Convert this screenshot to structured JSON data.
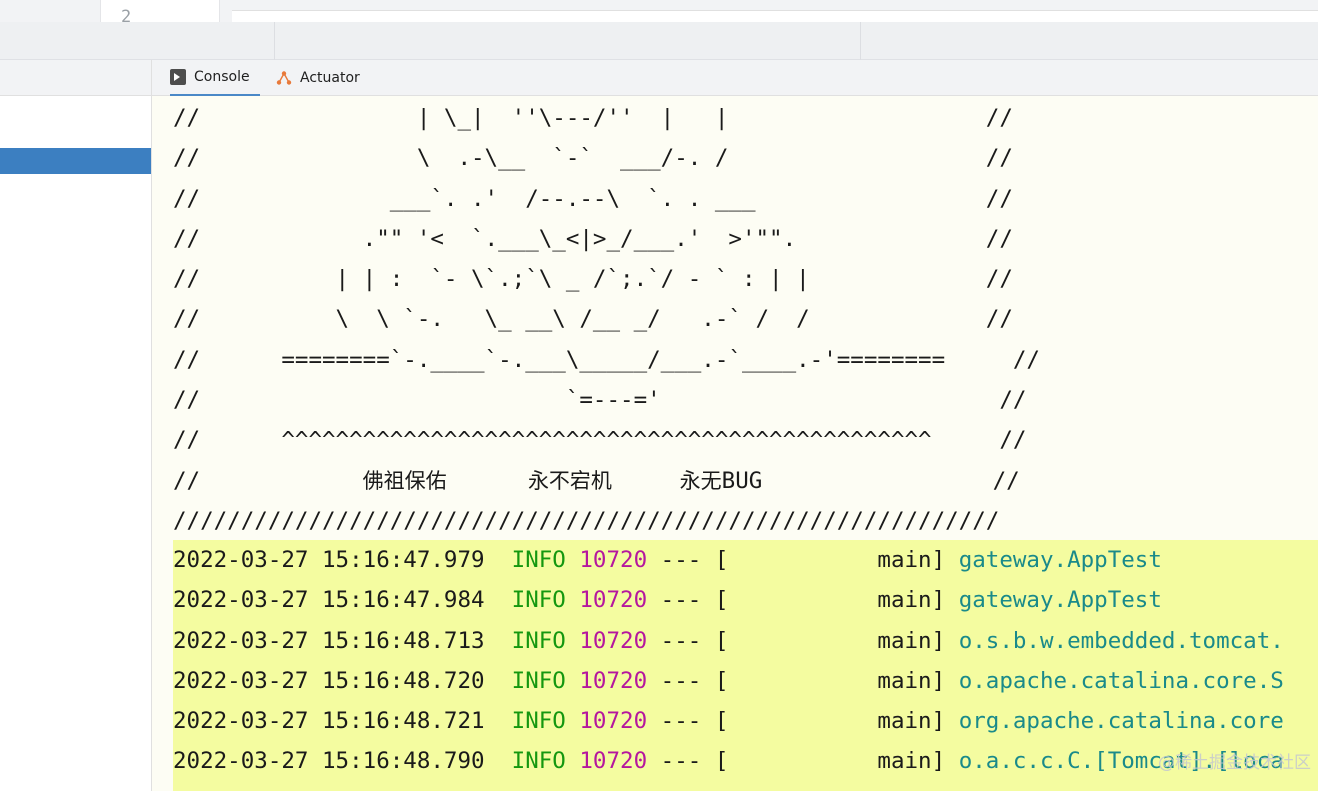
{
  "editor": {
    "line_number": "2"
  },
  "tabs": [
    {
      "label": "Console",
      "icon": "console-icon",
      "active": true
    },
    {
      "label": "Actuator",
      "icon": "actuator-icon",
      "active": false
    }
  ],
  "console": {
    "ascii_lines": [
      "//                | \\_|  ''\\---/''  |   |                   //",
      "//                \\  .-\\__  `-`  ___/-. /                   //",
      "//              ___`. .'  /--.--\\  `. . ___                 //",
      "//            .\"\" '<  `.___\\_<|>_/___.'  >'\"\".              //",
      "//          | | :  `- \\`.;`\\ _ /`;.`/ - ` : | |             //",
      "//          \\  \\ `-.   \\_ __\\ /__ _/   .-` /  /             //",
      "//      ========`-.____`-.___\\_____/___.-`____.-'========     //",
      "//                           `=---='                         //",
      "//      ^^^^^^^^^^^^^^^^^^^^^^^^^^^^^^^^^^^^^^^^^^^^^^^^     //"
    ],
    "blessing": {
      "prefix": "//",
      "phrase1": "佛祖保佑",
      "phrase2": "永不宕机",
      "phrase3_cn": "永无",
      "phrase3_en": "BUG",
      "suffix": "//"
    },
    "divider": "/////////////////////////////////////////////////////////////",
    "log_lines": [
      {
        "timestamp": "2022-03-27 15:16:47.979",
        "level": "INFO",
        "pid": "10720",
        "sep": "--- [",
        "thread": "main]",
        "logger": "gateway.AppTest"
      },
      {
        "timestamp": "2022-03-27 15:16:47.984",
        "level": "INFO",
        "pid": "10720",
        "sep": "--- [",
        "thread": "main]",
        "logger": "gateway.AppTest"
      },
      {
        "timestamp": "2022-03-27 15:16:48.713",
        "level": "INFO",
        "pid": "10720",
        "sep": "--- [",
        "thread": "main]",
        "logger": "o.s.b.w.embedded.tomcat."
      },
      {
        "timestamp": "2022-03-27 15:16:48.720",
        "level": "INFO",
        "pid": "10720",
        "sep": "--- [",
        "thread": "main]",
        "logger": "o.apache.catalina.core.S"
      },
      {
        "timestamp": "2022-03-27 15:16:48.721",
        "level": "INFO",
        "pid": "10720",
        "sep": "--- [",
        "thread": "main]",
        "logger": "org.apache.catalina.core"
      },
      {
        "timestamp": "2022-03-27 15:16:48.790",
        "level": "INFO",
        "pid": "10720",
        "sep": "--- [",
        "thread": "main]",
        "logger": "o.a.c.c.C.[Tomcat].[loca"
      }
    ]
  },
  "watermark": "@稀土掘金技术社区",
  "colors": {
    "level": "#14970f",
    "pid": "#b5179e",
    "logger": "#1a8a8a",
    "log_highlight": "#f4fca0",
    "selection": "#3c7fc1"
  }
}
